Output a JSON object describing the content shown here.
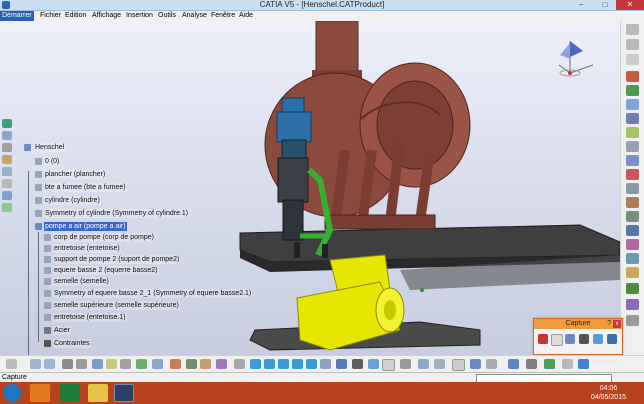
{
  "window": {
    "title": "CATIA V5 - [Henschel.CATProduct]",
    "minimize_glyph": "–",
    "maximize_glyph": "□",
    "close_glyph": "✕"
  },
  "menu": {
    "items": [
      {
        "label": "Démarrer",
        "active": true
      },
      {
        "label": "Fichier"
      },
      {
        "label": "Edition"
      },
      {
        "label": "Affichage"
      },
      {
        "label": "Insertion"
      },
      {
        "label": "Outils"
      },
      {
        "label": "Analyse"
      },
      {
        "label": "Fenêtre"
      },
      {
        "label": "Aide"
      }
    ]
  },
  "tree": {
    "nodes": [
      {
        "label": "Henschel",
        "selected": false
      },
      {
        "label": "0 (0)",
        "selected": false
      },
      {
        "label": "plancher (plancher)",
        "selected": false
      },
      {
        "label": "bte a fumee (bte a fumee)",
        "selected": false
      },
      {
        "label": "cylindre (cylindre)",
        "selected": false
      },
      {
        "label": "Symmetry of cylindre (Symmetry of cylindre.1)",
        "selected": false
      },
      {
        "label": "pompe a air (pompe a air)",
        "selected": true
      },
      {
        "label": "corp de pompe (corp de pompe)",
        "selected": false
      },
      {
        "label": "entretoise (entetoise)",
        "selected": false
      },
      {
        "label": "support de pompe 2 (suport de pompe2)",
        "selected": false
      },
      {
        "label": "equere basse 2 (equerre basse2)",
        "selected": false
      },
      {
        "label": "semelle (semelle)",
        "selected": false
      },
      {
        "label": "Symmetry of equere basse 2_1 (Symmetry of equere basse2.1)",
        "selected": false
      },
      {
        "label": "semelle supérieure (semelle supérieure)",
        "selected": false
      },
      {
        "label": "entretoise (entetoise.1)",
        "selected": false
      },
      {
        "label": "Acier",
        "selected": false
      },
      {
        "label": "Contraintes",
        "selected": false
      }
    ]
  },
  "capture_panel": {
    "title": "Capture",
    "help": "?",
    "close": "x"
  },
  "status": {
    "text": "Capture",
    "command_value": ""
  },
  "taskbar": {
    "time": "04:06",
    "date": "04/05/2015"
  },
  "colors": {
    "titlebar": "#c9e0f3",
    "menu_active": "#2b5fb3",
    "tree_selected": "#3a66c9",
    "boiler": "#8b4a3c",
    "pump": "#2d6fa8",
    "bracket_green": "#35b02f",
    "tank_yellow": "#e6e600",
    "taskbar": "#b8421e",
    "capture_title": "#f39a3a"
  },
  "icons": {
    "left_toolbar": [
      "sketch-icon",
      "part-icon",
      "product-icon",
      "constraint-icon",
      "measure-icon",
      "snap-icon",
      "catalog-icon",
      "sketch-plane-icon"
    ],
    "right_toolbar": [
      "new-component-icon",
      "existing-component-icon",
      "replace-icon",
      "graph-tree-icon",
      "multi-instantiate-icon",
      "move-icon",
      "manipulate-icon",
      "snap-icon",
      "explode-icon",
      "clash-icon",
      "sectioning-icon",
      "distance-icon",
      "constraint-icon",
      "fix-icon",
      "contact-icon",
      "offset-icon",
      "angle-icon",
      "reuse-pattern-icon",
      "update-icon",
      "bom-icon",
      "scene-icon"
    ],
    "capture_tools": [
      "record-icon",
      "select-icon",
      "image-icon",
      "camera-icon",
      "album-icon",
      "options-icon"
    ]
  }
}
